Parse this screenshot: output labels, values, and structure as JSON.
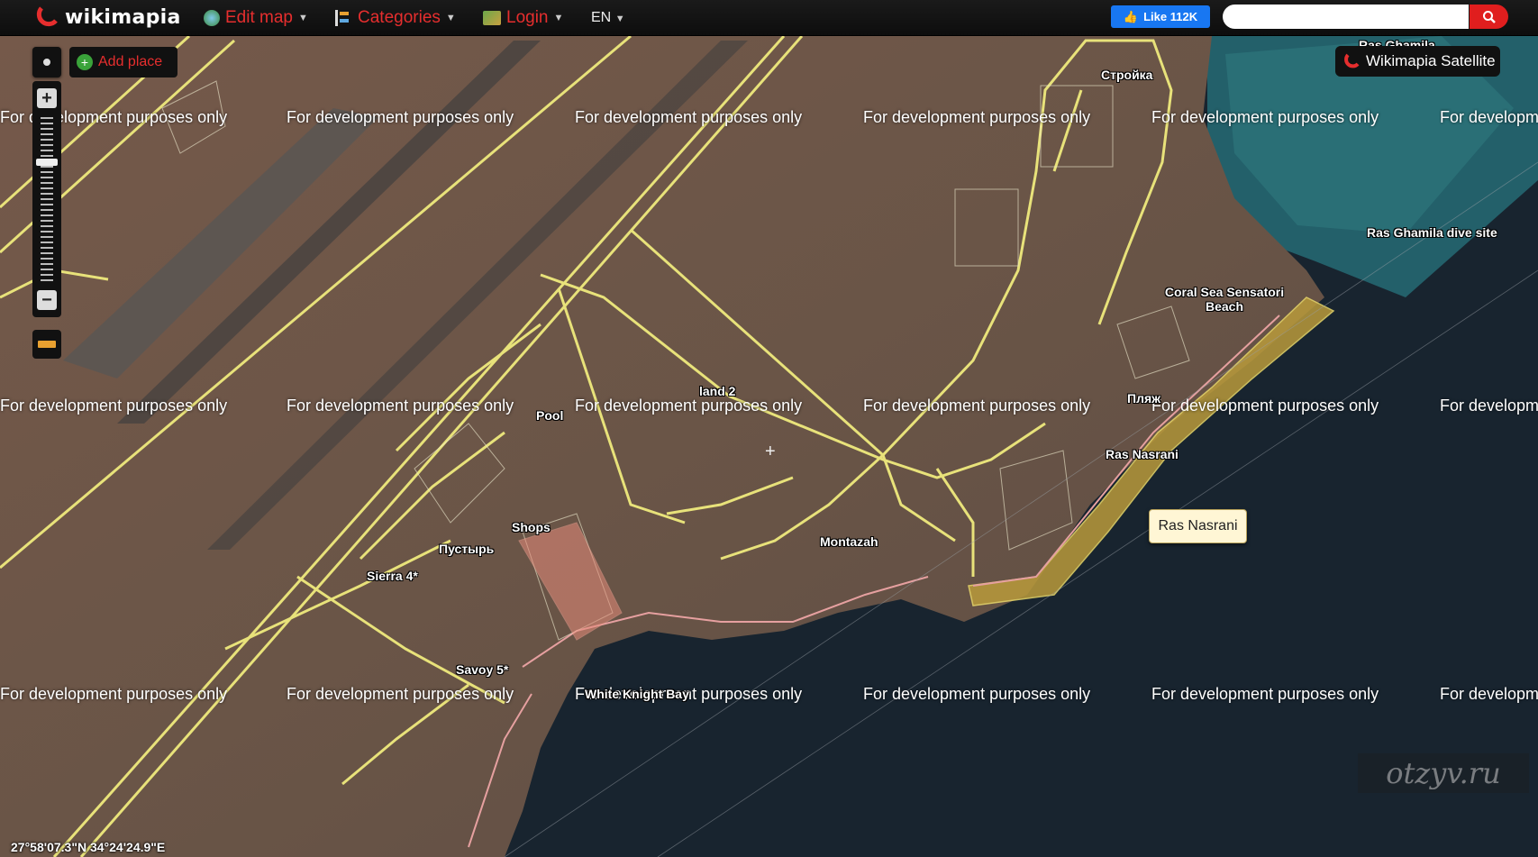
{
  "app": {
    "logo_text": "wikimapia"
  },
  "header": {
    "edit_map": "Edit map",
    "categories": "Categories",
    "login": "Login",
    "lang": "EN",
    "like_label": "Like 112K",
    "search_placeholder": ""
  },
  "controls": {
    "add_place": "Add place",
    "map_type": "Wikimapia Satellite",
    "zoom_in": "+",
    "zoom_out": "−"
  },
  "watermark": "For development purposes only",
  "places": [
    "Ras Ghamila",
    "Стройка",
    "Ras Ghamila dive site",
    "Coral Sea Sensatori Beach",
    "land 2",
    "Pool",
    "Пляж",
    "Ras Nasrani",
    "Shops",
    "Пустырь",
    "Montazah",
    "Sierra 4*",
    "Savoy 5*",
    "White Knight Bay"
  ],
  "tooltip": "Ras Nasrani",
  "coordinates": "27°58'07.3\"N 34°24'24.9\"E",
  "corner_watermark": "otzyv.ru",
  "colors": {
    "accent": "#e62e2e",
    "outline": "#e8e27a",
    "highlight": "#c8a63a",
    "sea": "#15222e",
    "land": "#6e5648"
  }
}
